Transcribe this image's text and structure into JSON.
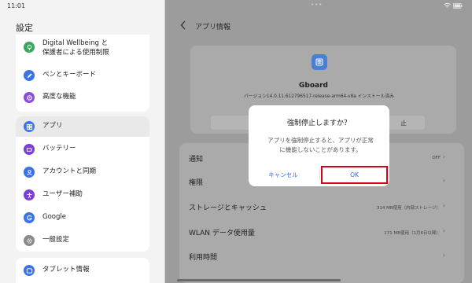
{
  "status": {
    "time": "11:01"
  },
  "settings": {
    "title": "設定",
    "top_items": [
      {
        "label_line1": "Digital Wellbeing と",
        "label_line2": "保護者による使用制限",
        "icon": "wellbeing-icon",
        "color": "#3aa55e"
      },
      {
        "label": "ペンとキーボード",
        "icon": "pen-icon",
        "color": "#3b73e6"
      },
      {
        "label": "高度な機能",
        "icon": "advanced-features-icon",
        "color": "#8a4fd8"
      }
    ],
    "mid_items": [
      {
        "label": "アプリ",
        "icon": "apps-icon",
        "color": "#3b73e6",
        "selected": true
      },
      {
        "label": "バッテリー",
        "icon": "battery-icon",
        "color": "#7a3fd6"
      },
      {
        "label": "アカウントと同期",
        "icon": "account-icon",
        "color": "#3b73e6"
      },
      {
        "label": "ユーザー補助",
        "icon": "accessibility-icon",
        "color": "#7a3fd6"
      },
      {
        "label": "Google",
        "icon": "google-icon",
        "color": "#3b73e6"
      },
      {
        "label": "一般設定",
        "icon": "gear-icon",
        "color": "#8a8a8a"
      }
    ],
    "bottom_items": [
      {
        "label": "タブレット情報",
        "icon": "tablet-icon",
        "color": "#3b73e6"
      }
    ]
  },
  "app_info": {
    "header_title": "アプリ情報",
    "app_name": "Gboard",
    "version": "バージョン14.0.11.612796517-release-arm64-v8a インストール済み",
    "button_left": "無効",
    "button_right": "止",
    "list": [
      {
        "label": "通知",
        "value": "OFF"
      },
      {
        "label": "権限",
        "value": ""
      },
      {
        "label": "ストレージとキャッシュ",
        "value": "314 MB使用（内部ストレージ）"
      },
      {
        "label": "WLAN データ使用量",
        "value": "171 MB使用（1月6日以降）"
      },
      {
        "label": "利用時間",
        "value": ""
      }
    ]
  },
  "dialog": {
    "title": "強制停止しますか？",
    "message_line1": "アプリを強制停止すると、アプリが正常",
    "message_line2": "に機能しないことがあります。",
    "cancel": "キャンセル",
    "ok": "OK",
    "highlight_color": "#d6001a"
  }
}
